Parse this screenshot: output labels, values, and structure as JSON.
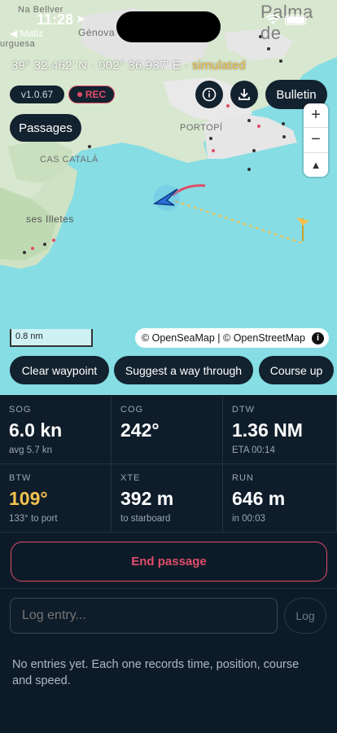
{
  "status_bar": {
    "time": "11:28",
    "back_app": "◀ Matiz"
  },
  "position": {
    "text": "39° 32.462' N · 002° 36.937' E · ",
    "simulated": "simulated"
  },
  "badges": {
    "version": "v1.0.67",
    "rec": "REC"
  },
  "buttons": {
    "bulletin": "Bulletin",
    "passages": "Passages"
  },
  "map": {
    "labels": {
      "genova": "Gènova",
      "portopi": "PORTOPÍ",
      "cas_catala": "CAS CATALÀ",
      "ses_illetes": "ses Illetes",
      "palma": "Palma de",
      "belver": "Na Bellver",
      "urgesa": "urguesa"
    },
    "scale": "0.8 nm",
    "attribution": "© OpenSeaMap | © OpenStreetMap",
    "zoom_in": "+",
    "zoom_out": "−",
    "compass": "▲"
  },
  "actions": {
    "clear_waypoint": "Clear waypoint",
    "suggest": "Suggest a way through",
    "course_up": "Course up"
  },
  "stats": [
    {
      "label": "SOG",
      "value": "6.0 kn",
      "sub": "avg 5.7 kn"
    },
    {
      "label": "COG",
      "value": "242°",
      "sub": ""
    },
    {
      "label": "DTW",
      "value": "1.36 NM",
      "sub": "ETA 00:14"
    },
    {
      "label": "BTW",
      "value": "109°",
      "sub": "133° to port"
    },
    {
      "label": "XTE",
      "value": "392 m",
      "sub": "to starboard"
    },
    {
      "label": "RUN",
      "value": "646 m",
      "sub": "in 00:03"
    }
  ],
  "end_passage": "End passage",
  "log": {
    "placeholder": "Log entry...",
    "button": "Log",
    "empty": "No entries yet. Each one records time, position, course and speed."
  },
  "colors": {
    "accent_red": "#e04c6a",
    "warning_yellow": "#f2c14e",
    "sea": "#86dde4",
    "panel": "#0f1d2a"
  },
  "icons": [
    "location-arrow-icon",
    "wifi-icon",
    "battery-icon",
    "info-icon",
    "download-icon",
    "boat-marker-icon",
    "waypoint-flag-icon"
  ]
}
